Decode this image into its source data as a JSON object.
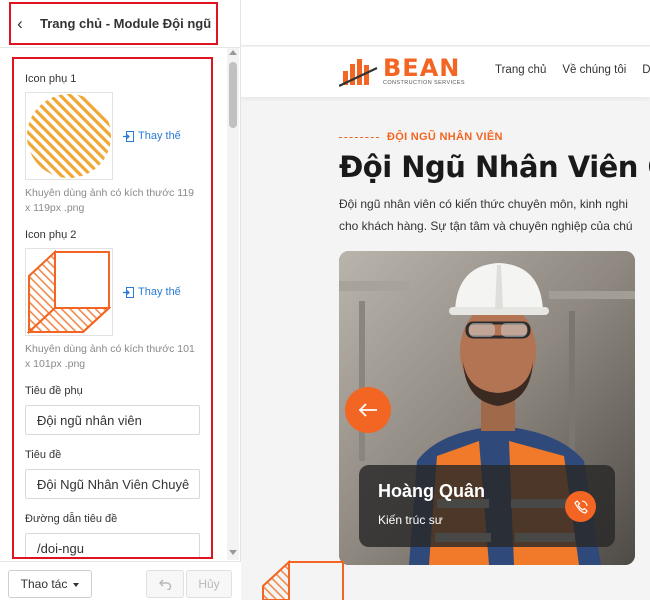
{
  "panel": {
    "title": "Trang chủ - Module Đội ngũ",
    "fields": {
      "icon1_label": "Icon phụ 1",
      "icon1_hint": "Khuyên dùng ảnh có kích thước 119 x 119px .png",
      "icon2_label": "Icon phụ 2",
      "icon2_hint": "Khuyên dùng ảnh có kích thước 101 x 101px .png",
      "replace_label": "Thay thế",
      "subtitle_label": "Tiêu đề phụ",
      "subtitle_value": "Đội ngũ nhân viên",
      "title_label": "Tiêu đề",
      "title_value": "Đội Ngũ Nhân Viên Chuyê",
      "link_label": "Đường dẫn tiêu đề",
      "link_value": "/doi-ngu"
    },
    "footer": {
      "actions_label": "Thao tác",
      "cancel_label": "Hủy"
    }
  },
  "preview": {
    "logo_name": "BEAN",
    "logo_sub": "CONSTRUCTION SERVICES",
    "nav": [
      "Trang chủ",
      "Về chúng tôi",
      "D"
    ],
    "eyebrow": "ĐỘI NGŨ NHÂN VIÊN",
    "section_title": "Đội Ngũ Nhân Viên C",
    "desc_line1": "Đội ngũ nhân viên có kiến thức chuyên môn, kinh nghi",
    "desc_line2": "cho khách hàng. Sự tận tâm và chuyên nghiệp của chú",
    "member": {
      "name": "Hoàng Quân",
      "role": "Kiến trúc sư"
    }
  },
  "colors": {
    "accent": "#f26522",
    "highlight_border": "#e0141e",
    "link": "#2a7bd6"
  },
  "icons": [
    "back-chevron-icon",
    "replace-image-icon",
    "undo-icon",
    "arrow-left-icon",
    "phone-icon"
  ]
}
